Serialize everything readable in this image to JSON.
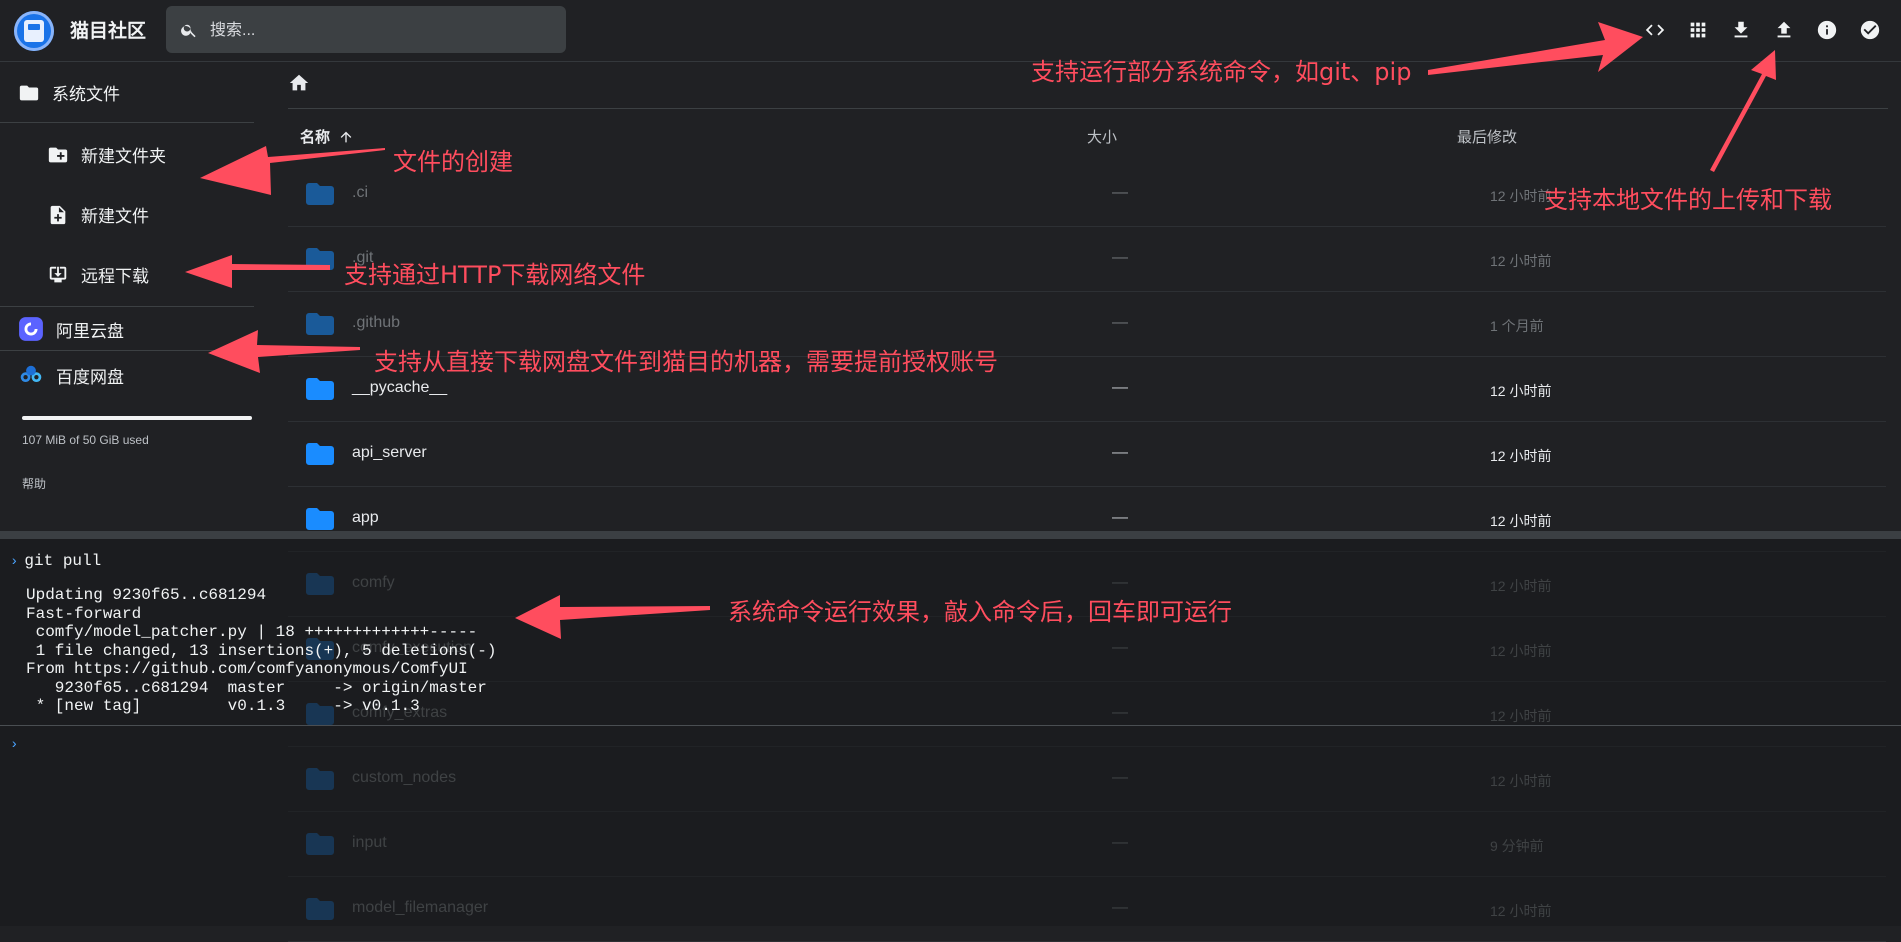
{
  "app": {
    "brand": "猫目社区",
    "search_placeholder": "搜索..."
  },
  "toolbar": {
    "buttons": [
      "code-icon",
      "grid-view-icon",
      "download-icon",
      "upload-icon",
      "info-icon",
      "check-circle-icon"
    ]
  },
  "sidebar": {
    "system_files": "系统文件",
    "new_folder": "新建文件夹",
    "new_file": "新建文件",
    "remote_download": "远程下载",
    "aliyun": "阿里云盘",
    "baidu": "百度网盘",
    "usage": "107 MiB of 50 GiB used",
    "usage_fraction": 0.002,
    "help": "帮助"
  },
  "table": {
    "col_name": "名称",
    "col_size": "大小",
    "col_modified": "最后修改",
    "rows": [
      {
        "name": ".ci",
        "size": "—",
        "modified": "12 小时前"
      },
      {
        "name": ".git",
        "size": "—",
        "modified": "12 小时前"
      },
      {
        "name": ".github",
        "size": "—",
        "modified": "1 个月前"
      },
      {
        "name": "__pycache__",
        "size": "—",
        "modified": "12 小时前"
      },
      {
        "name": "api_server",
        "size": "—",
        "modified": "12 小时前"
      },
      {
        "name": "app",
        "size": "—",
        "modified": "12 小时前"
      },
      {
        "name": "comfy",
        "size": "—",
        "modified": "12 小时前"
      },
      {
        "name": "comfy_execution",
        "size": "—",
        "modified": "12 小时前"
      },
      {
        "name": "comfy_extras",
        "size": "—",
        "modified": "12 小时前"
      },
      {
        "name": "custom_nodes",
        "size": "—",
        "modified": "12 小时前"
      },
      {
        "name": "input",
        "size": "—",
        "modified": "9 分钟前"
      },
      {
        "name": "model_filemanager",
        "size": "—",
        "modified": "12 小时前"
      }
    ]
  },
  "terminal": {
    "command": "git pull",
    "output": "Updating 9230f65..c681294\nFast-forward\n comfy/model_patcher.py | 18 +++++++++++++-----\n 1 file changed, 13 insertions(+), 5 deletions(-)\nFrom https://github.com/comfyanonymous/ComfyUI\n   9230f65..c681294  master     -> origin/master\n * [new tag]         v0.1.3     -> v0.1.3"
  },
  "annotations": {
    "commands": "支持运行部分系统命令，如git、pip",
    "create": "文件的创建",
    "upload_download": "支持本地文件的上传和下载",
    "http": "支持通过HTTP下载网络文件",
    "netdisk": "支持从直接下载网盘文件到猫目的机器，需要提前授权账号",
    "terminal": "系统命令运行效果，敲入命令后，回车即可运行"
  }
}
